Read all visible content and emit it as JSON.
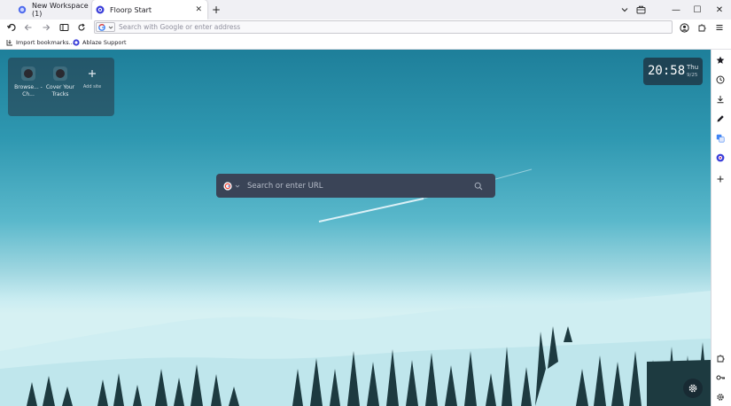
{
  "tabs": [
    {
      "label": "New Workspace (1)",
      "active": false
    },
    {
      "label": "Floorp Start",
      "active": true
    }
  ],
  "tab_close_glyph": "✕",
  "new_tab_glyph": "+",
  "window": {
    "minimize": "—",
    "maximize": "☐",
    "close": "✕"
  },
  "address_bar": {
    "placeholder": "Search with Google or enter address",
    "value": ""
  },
  "bookmarks": [
    {
      "label": "Import bookmarks...",
      "icon": "import-icon"
    },
    {
      "label": "Ablaze Support",
      "icon": "ablaze-icon"
    }
  ],
  "shortcuts": [
    {
      "label": "Browse... - Ch..."
    },
    {
      "label": "Cover Your Tracks"
    }
  ],
  "add_site_label": "Add site",
  "clock": {
    "time": "20:58",
    "day": "Thu",
    "date": "9/25"
  },
  "start_search": {
    "placeholder": "Search or enter URL",
    "value": ""
  },
  "colors": {
    "tab_bar_bg": "#f0f0f4",
    "search_bg": "#3a4457",
    "accent_blue": "#3b5bd9",
    "sky_top": "#1e7f9a",
    "snow": "#d6f1f3"
  },
  "sidebar_icons": [
    "star-icon",
    "history-icon",
    "download-icon",
    "pen-icon",
    "translate-icon",
    "floorp-icon",
    "add-icon",
    "puzzle-icon",
    "key-icon",
    "gear-icon"
  ]
}
